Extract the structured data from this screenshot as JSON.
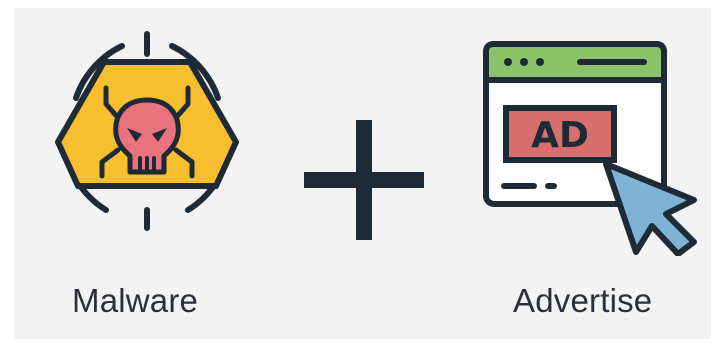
{
  "items": [
    {
      "label": "Malware",
      "icon": "malware-skull-icon"
    },
    {
      "label": "Advertise",
      "icon": "advertisement-click-icon",
      "badge_text": "AD"
    }
  ],
  "operator": {
    "icon": "plus-icon"
  },
  "colors": {
    "background": "#f3f3f3",
    "outline": "#1e2a36",
    "hazard_yellow": "#f7be2e",
    "skull_pink": "#e8737d",
    "browser_green": "#8cc26a",
    "ad_red": "#d86f6f",
    "cursor_blue": "#7fb3d6",
    "label_text": "#2c3038"
  }
}
